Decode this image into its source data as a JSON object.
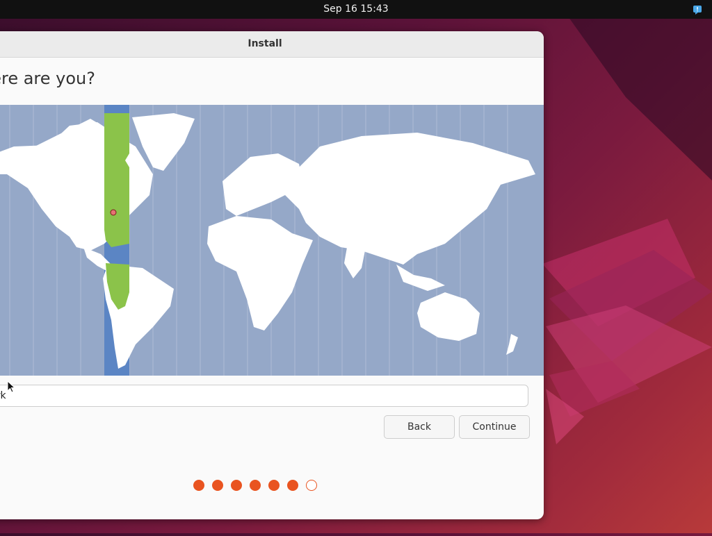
{
  "topbar": {
    "clock": "Sep 16  15:43",
    "notification_icon": "notification-icon"
  },
  "window": {
    "title": "Install",
    "heading": "here are you?",
    "timezone_input_value": "ew York",
    "back_label": "Back",
    "continue_label": "Continue",
    "progress": {
      "completed_steps": 6,
      "total_steps": 7
    }
  },
  "colors": {
    "accent": "#e95420",
    "map_ocean": "#95a8c8",
    "map_selected_zone": "#5b85c4",
    "map_selected_land": "#8bc34a",
    "topbar": "#111111"
  }
}
